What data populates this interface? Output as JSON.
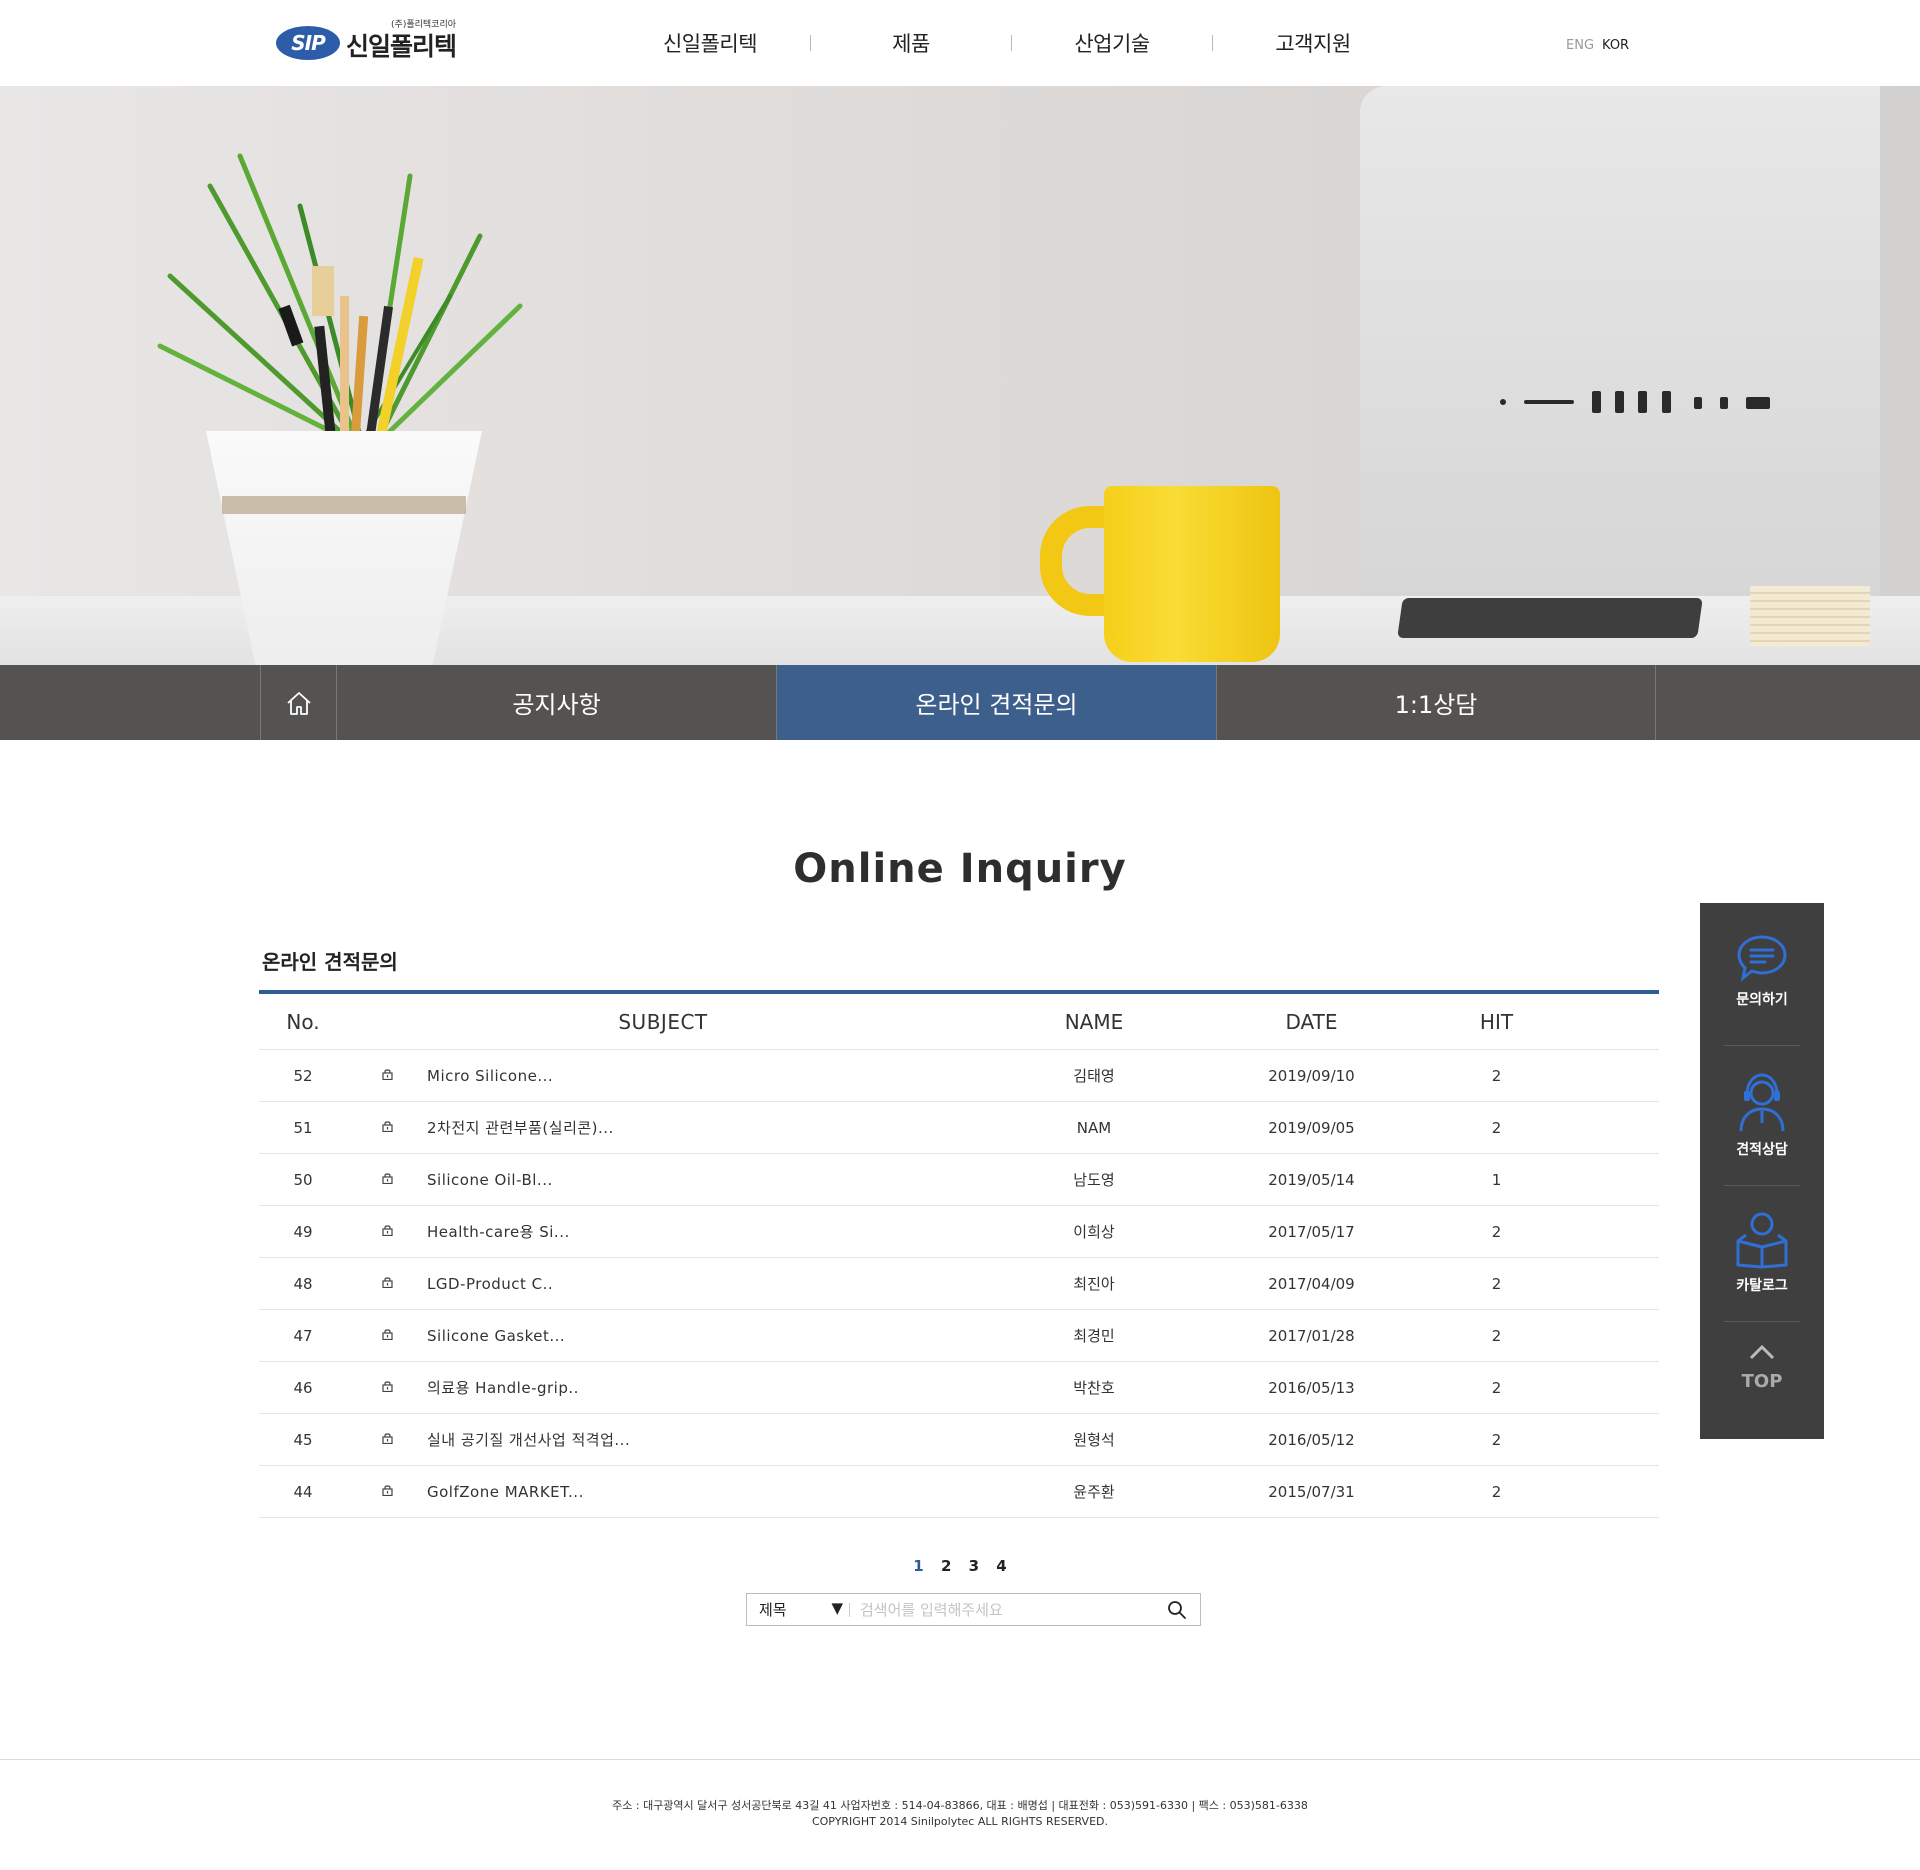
{
  "header": {
    "logo_mark": "SIP",
    "logo_name": "신일폴리텍",
    "logo_sub": "(주)폴리텍코리아",
    "nav": [
      "신일폴리텍",
      "제품",
      "산업기술",
      "고객지원"
    ],
    "lang": {
      "eng": "ENG",
      "kor": "KOR"
    }
  },
  "subnav": {
    "tabs": [
      "공지사항",
      "온라인 견적문의",
      "1:1상담"
    ],
    "active": "온라인 견적문의"
  },
  "page": {
    "heading": "Online Inquiry",
    "board_title": "온라인 견적문의"
  },
  "board": {
    "columns": {
      "no": "No.",
      "subject": "SUBJECT",
      "name": "NAME",
      "date": "DATE",
      "hit": "HIT"
    },
    "rows": [
      {
        "no": "52",
        "subject": "Micro Silicone...",
        "name": "김태영",
        "date": "2019/09/10",
        "hit": "2"
      },
      {
        "no": "51",
        "subject": "2차전지 관련부품(실리콘)...",
        "name": "NAM",
        "date": "2019/09/05",
        "hit": "2"
      },
      {
        "no": "50",
        "subject": "Silicone Oil-Bl...",
        "name": "남도영",
        "date": "2019/05/14",
        "hit": "1"
      },
      {
        "no": "49",
        "subject": "Health-care용 Si...",
        "name": "이희상",
        "date": "2017/05/17",
        "hit": "2"
      },
      {
        "no": "48",
        "subject": "LGD-Product C..",
        "name": "최진아",
        "date": "2017/04/09",
        "hit": "2"
      },
      {
        "no": "47",
        "subject": "Silicone Gasket...",
        "name": "최경민",
        "date": "2017/01/28",
        "hit": "2"
      },
      {
        "no": "46",
        "subject": "의료용 Handle-grip..",
        "name": "박찬호",
        "date": "2016/05/13",
        "hit": "2"
      },
      {
        "no": "45",
        "subject": "실내 공기질 개선사업 적격업...",
        "name": "원형석",
        "date": "2016/05/12",
        "hit": "2"
      },
      {
        "no": "44",
        "subject": "GolfZone MARKET...",
        "name": "윤주환",
        "date": "2015/07/31",
        "hit": "2"
      }
    ],
    "lock_icon": "lock-icon"
  },
  "pagination": {
    "pages": [
      "1",
      "2",
      "3",
      "4"
    ],
    "current": "1"
  },
  "search": {
    "select_value": "제목",
    "placeholder": "검색어를 입력해주세요"
  },
  "quick_menu": {
    "items": [
      "문의하기",
      "견적상담",
      "카탈로그"
    ],
    "top_label": "TOP"
  },
  "footer": {
    "address": "주소 : 대구광역시 달서구 성서공단북로 43길 41  사업자번호 : 514-04-83866, 대표 : 배명섭 | 대표전화 : 053)591-6330 | 팩스 : 053)581-6338",
    "copyright": "COPYRIGHT 2014 Sinilpolytec ALL RIGHTS RESERVED."
  },
  "colors": {
    "accent": "#2f5b97",
    "subnav_active": "#3d5f8c",
    "quick_bg": "#3f3f3f",
    "icon_blue": "#2f6fd6"
  }
}
